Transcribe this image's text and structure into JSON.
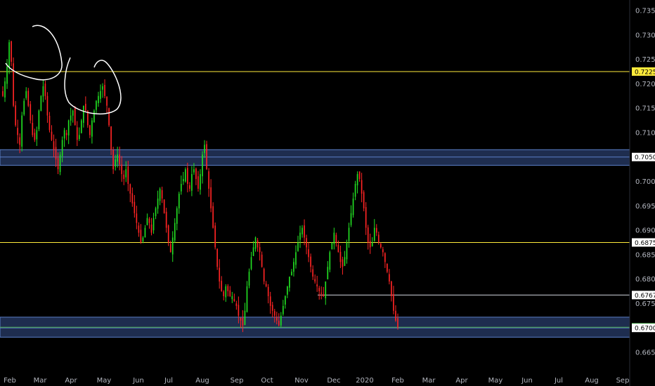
{
  "chart_data": {
    "type": "candlestick",
    "x_axis_labels": [
      "Feb",
      "Mar",
      "Apr",
      "May",
      "Jun",
      "Jul",
      "Aug",
      "Sep",
      "Oct",
      "Nov",
      "Dec",
      "2020",
      "Feb",
      "Mar",
      "Apr",
      "May",
      "Jun",
      "Jul",
      "Aug",
      "Sep"
    ],
    "y_axis_labels": [
      "0.73500",
      "0.73000",
      "0.72500",
      "0.72000",
      "0.71500",
      "0.71000",
      "0.70500",
      "0.70000",
      "0.69500",
      "0.69000",
      "0.68500",
      "0.68000",
      "0.67500",
      "0.67000",
      "0.66500"
    ],
    "ylim": [
      0.6625,
      0.7355
    ],
    "horizontal_lines": [
      {
        "value": 0.7225,
        "label": "0.72250",
        "color": "#ffeb3b",
        "label_bg": "#ffeb3b",
        "label_fg": "#000000",
        "span": "full"
      },
      {
        "value": 0.6875,
        "label": "0.68750",
        "color": "#ffeb3b",
        "label_bg": "#ffffff",
        "label_fg": "#000000",
        "span": "full"
      },
      {
        "value": 0.67673,
        "label": "0.67673",
        "color": "#d1d4dc",
        "label_bg": "#ffffff",
        "label_fg": "#000000",
        "span": "from-nov"
      },
      {
        "value": 0.67014,
        "label": "0.67014",
        "color": "#4caf50",
        "label_bg": "#4caf50",
        "label_fg": "#000000",
        "span": "full"
      }
    ],
    "zones": [
      {
        "top": 0.7065,
        "bottom": 0.7033,
        "mid": 0.705,
        "label": "0.70500",
        "fill": "#1e2d4f",
        "border": "#5b7fc7"
      },
      {
        "top": 0.6722,
        "bottom": 0.6681,
        "mid": 0.67,
        "label": "0.67000",
        "fill": "#1e2d4f",
        "border": "#5b7fc7"
      }
    ],
    "last_price": 0.67014,
    "up_color": "#22e022",
    "down_color": "#ff2424",
    "grid": false,
    "close_series": [
      0.7175,
      0.7205,
      0.7235,
      0.7285,
      0.7245,
      0.7155,
      0.7115,
      0.7095,
      0.7075,
      0.7135,
      0.7165,
      0.7185,
      0.7155,
      0.7125,
      0.7095,
      0.7085,
      0.7105,
      0.7145,
      0.7175,
      0.7195,
      0.7175,
      0.7135,
      0.7105,
      0.7085,
      0.7065,
      0.7045,
      0.7025,
      0.7055,
      0.7085,
      0.7105,
      0.7095,
      0.7125,
      0.7135,
      0.7145,
      0.7115,
      0.7085,
      0.7095,
      0.7125,
      0.7155,
      0.7145,
      0.7115,
      0.7095,
      0.7125,
      0.7145,
      0.7165,
      0.7175,
      0.7185,
      0.7195,
      0.7175,
      0.7155,
      0.7115,
      0.7065,
      0.7025,
      0.7045,
      0.7055,
      0.7035,
      0.7015,
      0.7005,
      0.7025,
      0.6995,
      0.6975,
      0.6955,
      0.6935,
      0.6915,
      0.6895,
      0.6875,
      0.6885,
      0.6905,
      0.6925,
      0.6915,
      0.6895,
      0.6925,
      0.6945,
      0.6965,
      0.6985,
      0.6965,
      0.6935,
      0.6905,
      0.6875,
      0.6855,
      0.6885,
      0.6915,
      0.6945,
      0.6975,
      0.6995,
      0.7005,
      0.7025,
      0.6995,
      0.6985,
      0.7015,
      0.7025,
      0.7005,
      0.6985,
      0.7015,
      0.7055,
      0.7075,
      0.7025,
      0.6985,
      0.6945,
      0.6905,
      0.6865,
      0.6825,
      0.6795,
      0.6775,
      0.6765,
      0.6785,
      0.6775,
      0.6765,
      0.6765,
      0.6755,
      0.6745,
      0.6725,
      0.6715,
      0.6705,
      0.6735,
      0.6785,
      0.6815,
      0.6845,
      0.6865,
      0.6885,
      0.6865,
      0.6855,
      0.6825,
      0.6795,
      0.6785,
      0.6765,
      0.6745,
      0.6735,
      0.6725,
      0.6715,
      0.6705,
      0.6725,
      0.6745,
      0.6765,
      0.6785,
      0.6805,
      0.6815,
      0.6835,
      0.6855,
      0.6875,
      0.6895,
      0.6905,
      0.6885,
      0.6865,
      0.6845,
      0.6825,
      0.6805,
      0.6795,
      0.6785,
      0.6775,
      0.677,
      0.6765,
      0.6795,
      0.6825,
      0.6855,
      0.6875,
      0.6895,
      0.6875,
      0.6855,
      0.6835,
      0.6825,
      0.6845,
      0.6875,
      0.6905,
      0.6935,
      0.6965,
      0.6995,
      0.7015,
      0.7005,
      0.6975,
      0.6945,
      0.6905,
      0.6875,
      0.6865,
      0.6875,
      0.6905,
      0.6895,
      0.6875,
      0.6865,
      0.6855,
      0.6835,
      0.6815,
      0.6795,
      0.6765,
      0.6735,
      0.6715,
      0.6701
    ]
  }
}
